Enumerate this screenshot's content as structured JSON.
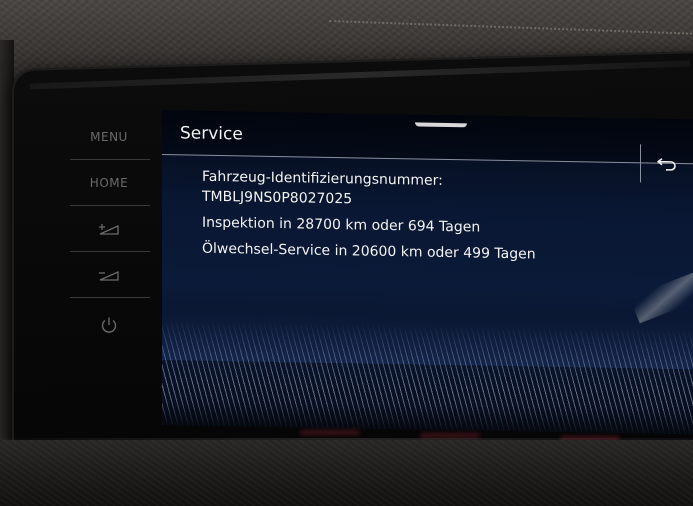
{
  "sidebar": {
    "buttons": [
      {
        "label": "MENU"
      },
      {
        "label": "HOME"
      },
      {
        "icon": "brightness-up-icon"
      },
      {
        "icon": "brightness-down-icon"
      },
      {
        "icon": "power-icon"
      }
    ]
  },
  "screen": {
    "title": "Service",
    "back_icon": "back-arrow-icon",
    "info": {
      "vin_label": "Fahrzeug-Identifizierungsnummer:",
      "vin_value": "TMBLJ9NS0P8027025",
      "inspection": "Inspektion in 28700 km oder 694 Tagen",
      "oil_service": "Ölwechsel-Service in 20600 km oder 499 Tagen"
    }
  },
  "colors": {
    "screen_background": "#0b1a38",
    "text": "#f4f4f4",
    "button_text": "#6b6b6b"
  }
}
